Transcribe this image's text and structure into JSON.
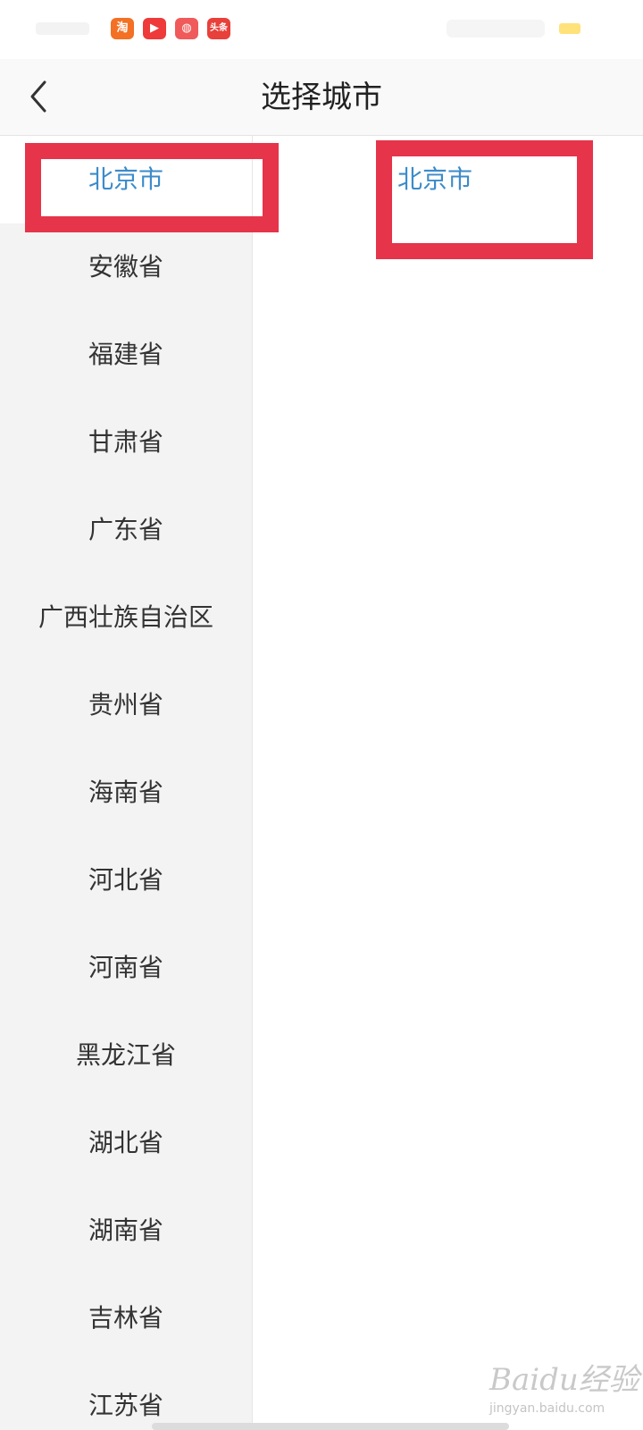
{
  "status_bar": {
    "app_icons": [
      {
        "name": "taobao-icon",
        "label": "淘",
        "color": "#f37024"
      },
      {
        "name": "video-play-icon",
        "label": "▶",
        "color": "#ee3a3a"
      },
      {
        "name": "social-app-icon",
        "label": "◍",
        "color": "#f05a5a"
      },
      {
        "name": "toutiao-icon",
        "label": "头条",
        "color": "#e8403a"
      }
    ],
    "battery_color": "#ffe27a"
  },
  "header": {
    "back_icon": "chevron-left-icon",
    "title": "选择城市"
  },
  "provinces": [
    {
      "label": "北京市",
      "selected": true
    },
    {
      "label": "安徽省",
      "selected": false
    },
    {
      "label": "福建省",
      "selected": false
    },
    {
      "label": "甘肃省",
      "selected": false
    },
    {
      "label": "广东省",
      "selected": false
    },
    {
      "label": "广西壮族自治区",
      "selected": false
    },
    {
      "label": "贵州省",
      "selected": false
    },
    {
      "label": "海南省",
      "selected": false
    },
    {
      "label": "河北省",
      "selected": false
    },
    {
      "label": "河南省",
      "selected": false
    },
    {
      "label": "黑龙江省",
      "selected": false
    },
    {
      "label": "湖北省",
      "selected": false
    },
    {
      "label": "湖南省",
      "selected": false
    },
    {
      "label": "吉林省",
      "selected": false
    },
    {
      "label": "江苏省",
      "selected": false
    }
  ],
  "cities": [
    {
      "label": "北京市"
    }
  ],
  "colors": {
    "accent": "#3c8bc9",
    "highlight": "#e6344a"
  },
  "watermark": {
    "brand": "Baidu经验",
    "url": "jingyan.baidu.com"
  }
}
